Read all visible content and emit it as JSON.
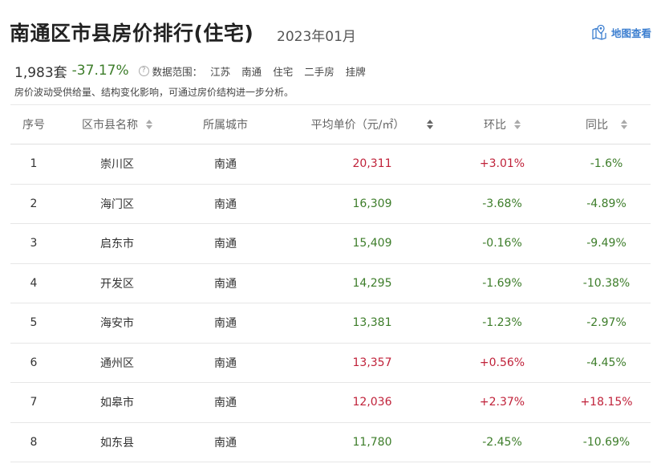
{
  "header": {
    "title": "南通区市县房价排行(住宅)",
    "date": "2023年01月",
    "map_link": "地图查看"
  },
  "summary": {
    "count": "1,983套",
    "change": "-37.17%",
    "help": "?",
    "scope_label": "数据范围：",
    "scope": [
      "江苏",
      "南通",
      "住宅",
      "二手房",
      "挂牌"
    ]
  },
  "note": "房价波动受供给量、结构变化影响，可通过房价结构进一步分析。",
  "table": {
    "headers": {
      "rank": "序号",
      "name": "区市县名称",
      "city": "所属城市",
      "price": "平均单价（元/㎡）",
      "mom": "环比",
      "yoy": "同比"
    },
    "rows": [
      {
        "rank": "1",
        "name": "崇川区",
        "city": "南通",
        "price": "20,311",
        "mom": "+3.01%",
        "yoy": "-1.6%"
      },
      {
        "rank": "2",
        "name": "海门区",
        "city": "南通",
        "price": "16,309",
        "mom": "-3.68%",
        "yoy": "-4.89%"
      },
      {
        "rank": "3",
        "name": "启东市",
        "city": "南通",
        "price": "15,409",
        "mom": "-0.16%",
        "yoy": "-9.49%"
      },
      {
        "rank": "4",
        "name": "开发区",
        "city": "南通",
        "price": "14,295",
        "mom": "-1.69%",
        "yoy": "-10.38%"
      },
      {
        "rank": "5",
        "name": "海安市",
        "city": "南通",
        "price": "13,381",
        "mom": "-1.23%",
        "yoy": "-2.97%"
      },
      {
        "rank": "6",
        "name": "通州区",
        "city": "南通",
        "price": "13,357",
        "mom": "+0.56%",
        "yoy": "-4.45%"
      },
      {
        "rank": "7",
        "name": "如皋市",
        "city": "南通",
        "price": "12,036",
        "mom": "+2.37%",
        "yoy": "+18.15%"
      },
      {
        "rank": "8",
        "name": "如东县",
        "city": "南通",
        "price": "11,780",
        "mom": "-2.45%",
        "yoy": "-10.69%"
      }
    ]
  },
  "colors": {
    "rise": "#c0223a",
    "fall": "#3d7d2a",
    "link": "#3d7fd0"
  }
}
